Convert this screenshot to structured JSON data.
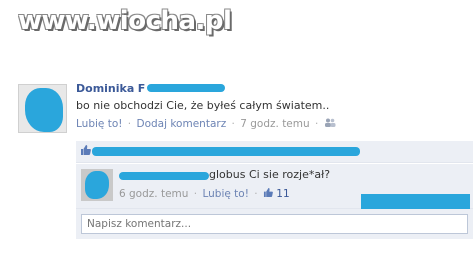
{
  "watermark": {
    "text": "www.wiocha.pl"
  },
  "post": {
    "author_first": "Dominika",
    "author_initial": "F",
    "text": "bo nie obchodzi Cie, że byłeś całym światem..",
    "actions": {
      "like": "Lubię to!",
      "comment": "Dodaj komentarz",
      "time": "7 godz. temu"
    }
  },
  "comment": {
    "text": "globus Ci sie rozje*ał?",
    "time": "6 godz. temu",
    "like": "Lubię to!",
    "like_count": "11"
  },
  "reply": {
    "placeholder": "Napisz komentarz..."
  },
  "colors": {
    "link": "#6d84b4",
    "name": "#3b5998",
    "panel": "#eceff5",
    "redaction": "#2aa6dc"
  }
}
